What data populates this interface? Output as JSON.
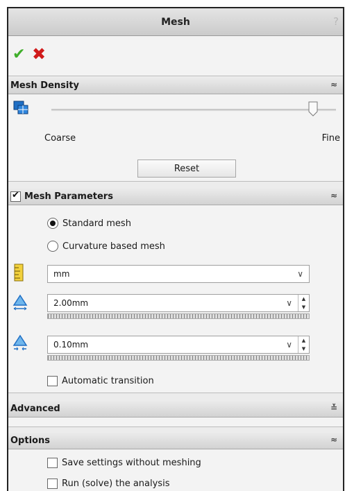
{
  "window": {
    "title": "Mesh",
    "help_glyph": "?"
  },
  "actions": {
    "ok_glyph": "✔",
    "cancel_glyph": "✖"
  },
  "mesh_density": {
    "header": "Mesh Density",
    "collapse_glyph": "≈",
    "slider_left_label": "Coarse",
    "slider_right_label": "Fine",
    "slider_level": 0.92,
    "reset_label": "Reset"
  },
  "mesh_parameters": {
    "header": "Mesh Parameters",
    "enabled": true,
    "collapse_glyph": "≈",
    "options": [
      {
        "label": "Standard mesh",
        "selected": true
      },
      {
        "label": "Curvature based mesh",
        "selected": false
      }
    ],
    "unit_value": "mm",
    "element_size": "2.00mm",
    "tolerance": "0.10mm",
    "automatic_transition_label": "Automatic transition",
    "automatic_transition_checked": false,
    "dropdown_glyph": "∨"
  },
  "advanced": {
    "header": "Advanced",
    "expand_glyph": "≚"
  },
  "options": {
    "header": "Options",
    "collapse_glyph": "≈",
    "items": [
      {
        "label": "Save settings without meshing",
        "checked": false
      },
      {
        "label": "Run (solve) the analysis",
        "checked": false
      }
    ]
  },
  "colors": {
    "accent_blue": "#1f6fc4",
    "ok_green": "#3fae2a",
    "cancel_red": "#d01a1a",
    "ruler_yellow": "#f2d13c"
  }
}
